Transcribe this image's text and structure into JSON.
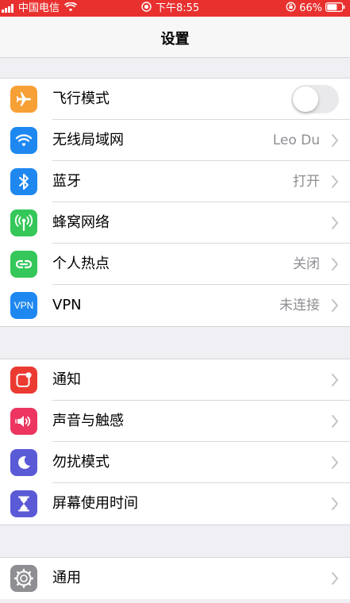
{
  "status_bar": {
    "carrier": "中国电信",
    "time": "下午8:55",
    "battery": "66%",
    "background_color": "#e8312f"
  },
  "nav": {
    "title": "设置"
  },
  "groups": [
    {
      "items": [
        {
          "label": "飞行模式",
          "value": "",
          "icon": "airplane-icon",
          "icon_color": "#f7a035",
          "control": "toggle",
          "toggle_on": false
        },
        {
          "label": "无线局域网",
          "value": "Leo Du",
          "icon": "wifi-icon",
          "icon_color": "#1e88f0",
          "control": "chevron"
        },
        {
          "label": "蓝牙",
          "value": "打开",
          "icon": "bluetooth-icon",
          "icon_color": "#1e88f0",
          "control": "chevron"
        },
        {
          "label": "蜂窝网络",
          "value": "",
          "icon": "antenna-icon",
          "icon_color": "#35c759",
          "control": "chevron"
        },
        {
          "label": "个人热点",
          "value": "关闭",
          "icon": "hotspot-icon",
          "icon_color": "#35c759",
          "control": "chevron"
        },
        {
          "label": "VPN",
          "value": "未连接",
          "icon": "vpn-icon",
          "icon_text": "VPN",
          "icon_color": "#1e88f0",
          "control": "chevron"
        }
      ]
    },
    {
      "items": [
        {
          "label": "通知",
          "value": "",
          "icon": "notification-icon",
          "icon_color": "#eb3b31",
          "control": "chevron"
        },
        {
          "label": "声音与触感",
          "value": "",
          "icon": "speaker-icon",
          "icon_color": "#ec3560",
          "control": "chevron"
        },
        {
          "label": "勿扰模式",
          "value": "",
          "icon": "moon-icon",
          "icon_color": "#5b5ad6",
          "control": "chevron"
        },
        {
          "label": "屏幕使用时间",
          "value": "",
          "icon": "hourglass-icon",
          "icon_color": "#5b5ad6",
          "control": "chevron"
        }
      ]
    },
    {
      "items": [
        {
          "label": "通用",
          "value": "",
          "icon": "gear-icon",
          "icon_color": "#8e8e93",
          "control": "chevron"
        }
      ]
    }
  ]
}
